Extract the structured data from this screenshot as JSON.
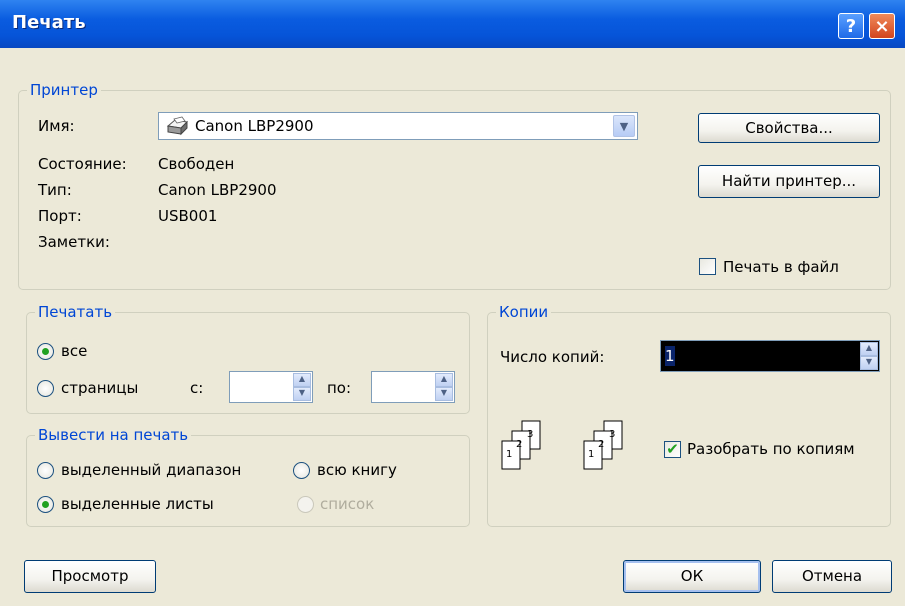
{
  "title": "Печать",
  "title_buttons": {
    "help": "?",
    "close": "×"
  },
  "printer": {
    "group_label": "Принтер",
    "name_label": "Имя:",
    "name_value": "Canon LBP2900",
    "status_label": "Состояние:",
    "status_value": "Свободен",
    "type_label": "Тип:",
    "type_value": "Canon LBP2900",
    "port_label": "Порт:",
    "port_value": "USB001",
    "notes_label": "Заметки:",
    "properties_button": "Свойства...",
    "find_button": "Найти принтер...",
    "print_to_file_label": "Печать в файл",
    "print_to_file_checked": false
  },
  "print_range": {
    "group_label": "Печатать",
    "all_label": "все",
    "pages_label": "страницы",
    "from_label": "с:",
    "to_label": "по:",
    "from_value": "",
    "to_value": "",
    "selected": "all"
  },
  "print_what": {
    "group_label": "Вывести на печать",
    "selection_label": "выделенный диапазон",
    "workbook_label": "всю книгу",
    "active_sheets_label": "выделенные листы",
    "list_label": "список",
    "selected": "active_sheets"
  },
  "copies": {
    "group_label": "Копии",
    "count_label": "Число копий:",
    "count_value": "1",
    "collate_label": "Разобрать по копиям",
    "collate_checked": true,
    "page_numbers": [
      "1",
      "2",
      "3"
    ]
  },
  "footer": {
    "preview_button": "Просмотр",
    "ok_button": "ОК",
    "cancel_button": "Отмена"
  },
  "colors": {
    "titlebar": "#0654d8",
    "group_label": "#0046d5",
    "dialog_bg": "#ece9d8",
    "check": "#21a121"
  }
}
